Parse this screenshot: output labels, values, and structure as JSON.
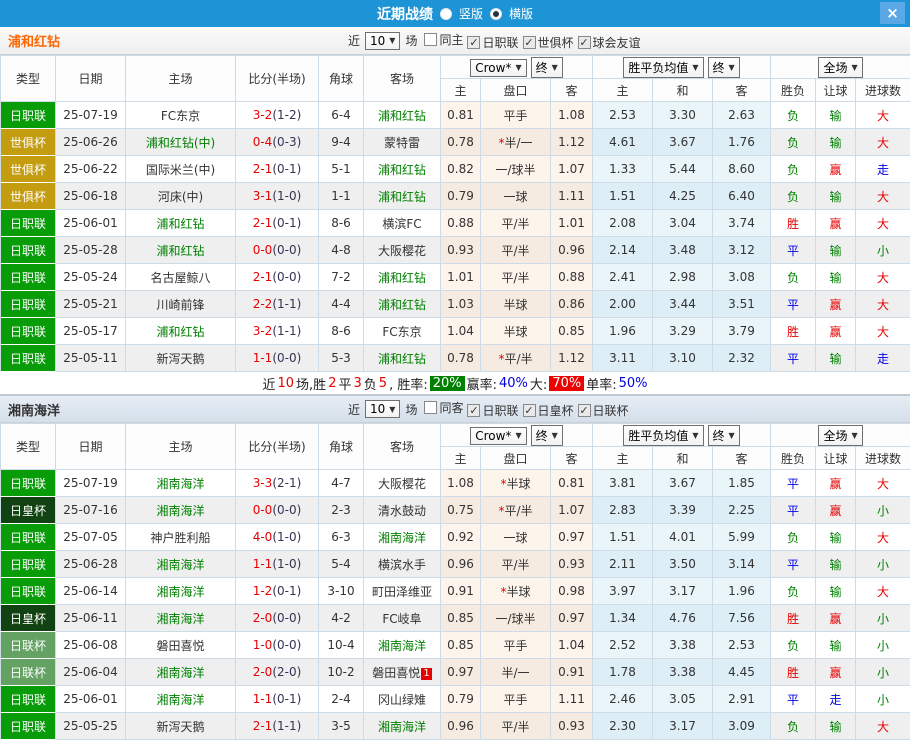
{
  "titlebar": {
    "title": "近期战绩",
    "layout_options": [
      {
        "label": "竖版",
        "selected": false
      },
      {
        "label": "横版",
        "selected": true
      }
    ],
    "close": "×"
  },
  "theme": {
    "titlebar_bg": "#1d94d6",
    "close_btn_bg": "#5aa9e6",
    "section1_name_color": "#ff6600",
    "win_color": "#e60000",
    "draw_color": "#0000e6",
    "lose_color": "#008000",
    "type_colors": {
      "日职联": "#089c08",
      "世俱杯": "#c39c10",
      "日皇杯": "#114211",
      "日联杯": "#63a263"
    }
  },
  "table_header": {
    "cols": [
      "类型",
      "日期",
      "主场",
      "比分(半场)",
      "角球",
      "客场"
    ],
    "sub": [
      "主",
      "盘口",
      "客",
      "主",
      "和",
      "客",
      "胜负",
      "让球",
      "进球数"
    ],
    "selects": {
      "odds_source": "Crow*",
      "odds_stage": "终",
      "avg_label": "胜平负均值",
      "avg_stage": "终",
      "scope": "全场"
    }
  },
  "sections": [
    {
      "name": "浦和红钻",
      "near_label": "近",
      "count": "10",
      "games_label": "场",
      "filters": [
        {
          "label": "同主",
          "checked": false
        },
        {
          "label": "日职联",
          "checked": true
        },
        {
          "label": "世俱杯",
          "checked": true
        },
        {
          "label": "球会友谊",
          "checked": true
        }
      ],
      "rows": [
        {
          "type": "日职联",
          "date": "25-07-19",
          "home": "FC东京",
          "home_green": false,
          "score": "3-2",
          "half": "(1-2)",
          "corner": "6-4",
          "away": "浦和红钻",
          "away_green": true,
          "odds": [
            "0.81",
            "平手",
            "1.08"
          ],
          "avg": [
            "2.53",
            "3.30",
            "2.63"
          ],
          "res": "负",
          "let": "输",
          "goal": "大"
        },
        {
          "type": "世俱杯",
          "date": "25-06-26",
          "home": "浦和红钻(中)",
          "home_green": true,
          "score": "0-4",
          "half": "(0-3)",
          "corner": "9-4",
          "away": "蒙特雷",
          "away_green": false,
          "odds": [
            "0.78",
            "*半/一",
            "1.12"
          ],
          "avg": [
            "4.61",
            "3.67",
            "1.76"
          ],
          "res": "负",
          "let": "输",
          "goal": "大"
        },
        {
          "type": "世俱杯",
          "date": "25-06-22",
          "home": "国际米兰(中)",
          "home_green": false,
          "score": "2-1",
          "half": "(0-1)",
          "corner": "5-1",
          "away": "浦和红钻",
          "away_green": true,
          "odds": [
            "0.82",
            "一/球半",
            "1.07"
          ],
          "avg": [
            "1.33",
            "5.44",
            "8.60"
          ],
          "res": "负",
          "let": "赢",
          "goal": "走"
        },
        {
          "type": "世俱杯",
          "date": "25-06-18",
          "home": "河床(中)",
          "home_green": false,
          "score": "3-1",
          "half": "(1-0)",
          "corner": "1-1",
          "away": "浦和红钻",
          "away_green": true,
          "odds": [
            "0.79",
            "一球",
            "1.11"
          ],
          "avg": [
            "1.51",
            "4.25",
            "6.40"
          ],
          "res": "负",
          "let": "输",
          "goal": "大"
        },
        {
          "type": "日职联",
          "date": "25-06-01",
          "home": "浦和红钻",
          "home_green": true,
          "score": "2-1",
          "half": "(0-1)",
          "corner": "8-6",
          "away": "横滨FC",
          "away_green": false,
          "odds": [
            "0.88",
            "平/半",
            "1.01"
          ],
          "avg": [
            "2.08",
            "3.04",
            "3.74"
          ],
          "res": "胜",
          "let": "赢",
          "goal": "大"
        },
        {
          "type": "日职联",
          "date": "25-05-28",
          "home": "浦和红钻",
          "home_green": true,
          "score": "0-0",
          "half": "(0-0)",
          "corner": "4-8",
          "away": "大阪樱花",
          "away_green": false,
          "odds": [
            "0.93",
            "平/半",
            "0.96"
          ],
          "avg": [
            "2.14",
            "3.48",
            "3.12"
          ],
          "res": "平",
          "let": "输",
          "goal": "小"
        },
        {
          "type": "日职联",
          "date": "25-05-24",
          "home": "名古屋鲸八",
          "home_green": false,
          "score": "2-1",
          "half": "(0-0)",
          "corner": "7-2",
          "away": "浦和红钻",
          "away_green": true,
          "odds": [
            "1.01",
            "平/半",
            "0.88"
          ],
          "avg": [
            "2.41",
            "2.98",
            "3.08"
          ],
          "res": "负",
          "let": "输",
          "goal": "大"
        },
        {
          "type": "日职联",
          "date": "25-05-21",
          "home": "川崎前锋",
          "home_green": false,
          "score": "2-2",
          "half": "(1-1)",
          "corner": "4-4",
          "away": "浦和红钻",
          "away_green": true,
          "odds": [
            "1.03",
            "半球",
            "0.86"
          ],
          "avg": [
            "2.00",
            "3.44",
            "3.51"
          ],
          "res": "平",
          "let": "赢",
          "goal": "大"
        },
        {
          "type": "日职联",
          "date": "25-05-17",
          "home": "浦和红钻",
          "home_green": true,
          "score": "3-2",
          "half": "(1-1)",
          "corner": "8-6",
          "away": "FC东京",
          "away_green": false,
          "odds": [
            "1.04",
            "半球",
            "0.85"
          ],
          "avg": [
            "1.96",
            "3.29",
            "3.79"
          ],
          "res": "胜",
          "let": "赢",
          "goal": "大"
        },
        {
          "type": "日职联",
          "date": "25-05-11",
          "home": "新泻天鹅",
          "home_green": false,
          "score": "1-1",
          "half": "(0-0)",
          "corner": "5-3",
          "away": "浦和红钻",
          "away_green": true,
          "odds": [
            "0.78",
            "*平/半",
            "1.12"
          ],
          "avg": [
            "3.11",
            "3.10",
            "2.32"
          ],
          "res": "平",
          "let": "输",
          "goal": "走"
        }
      ],
      "summary": [
        {
          "t": "近"
        },
        {
          "t": "10",
          "c": "red"
        },
        {
          "t": "场,胜"
        },
        {
          "t": "2",
          "c": "red"
        },
        {
          "t": "平"
        },
        {
          "t": "3",
          "c": "red"
        },
        {
          "t": "负"
        },
        {
          "t": "5",
          "c": "red"
        },
        {
          "t": ", 胜率: "
        },
        {
          "t": "20%",
          "badge": "green"
        },
        {
          "t": " 赢率:"
        },
        {
          "t": "40%",
          "c": "blue"
        },
        {
          "t": " 大: "
        },
        {
          "t": "70%",
          "badge": "red"
        },
        {
          "t": " 单率:"
        },
        {
          "t": "50%",
          "c": "blue"
        }
      ]
    },
    {
      "name": "湘南海洋",
      "near_label": "近",
      "count": "10",
      "games_label": "场",
      "filters": [
        {
          "label": "同客",
          "checked": false
        },
        {
          "label": "日职联",
          "checked": true
        },
        {
          "label": "日皇杯",
          "checked": true
        },
        {
          "label": "日联杯",
          "checked": true
        }
      ],
      "rows": [
        {
          "type": "日职联",
          "date": "25-07-19",
          "home": "湘南海洋",
          "home_green": true,
          "score": "3-3",
          "half": "(2-1)",
          "corner": "4-7",
          "away": "大阪樱花",
          "away_green": false,
          "odds": [
            "1.08",
            "*半球",
            "0.81"
          ],
          "avg": [
            "3.81",
            "3.67",
            "1.85"
          ],
          "res": "平",
          "let": "赢",
          "goal": "大"
        },
        {
          "type": "日皇杯",
          "date": "25-07-16",
          "home": "湘南海洋",
          "home_green": true,
          "score": "0-0",
          "half": "(0-0)",
          "corner": "2-3",
          "away": "清水鼓动",
          "away_green": false,
          "odds": [
            "0.75",
            "*平/半",
            "1.07"
          ],
          "avg": [
            "2.83",
            "3.39",
            "2.25"
          ],
          "res": "平",
          "let": "赢",
          "goal": "小"
        },
        {
          "type": "日职联",
          "date": "25-07-05",
          "home": "神户胜利船",
          "home_green": false,
          "score": "4-0",
          "half": "(1-0)",
          "corner": "6-3",
          "away": "湘南海洋",
          "away_green": true,
          "odds": [
            "0.92",
            "一球",
            "0.97"
          ],
          "avg": [
            "1.51",
            "4.01",
            "5.99"
          ],
          "res": "负",
          "let": "输",
          "goal": "大"
        },
        {
          "type": "日职联",
          "date": "25-06-28",
          "home": "湘南海洋",
          "home_green": true,
          "score": "1-1",
          "half": "(1-0)",
          "corner": "5-4",
          "away": "横滨水手",
          "away_green": false,
          "odds": [
            "0.96",
            "平/半",
            "0.93"
          ],
          "avg": [
            "2.11",
            "3.50",
            "3.14"
          ],
          "res": "平",
          "let": "输",
          "goal": "小"
        },
        {
          "type": "日职联",
          "date": "25-06-14",
          "home": "湘南海洋",
          "home_green": true,
          "score": "1-2",
          "half": "(0-1)",
          "corner": "3-10",
          "away": "町田泽维亚",
          "away_green": false,
          "odds": [
            "0.91",
            "*半球",
            "0.98"
          ],
          "avg": [
            "3.97",
            "3.17",
            "1.96"
          ],
          "res": "负",
          "let": "输",
          "goal": "大"
        },
        {
          "type": "日皇杯",
          "date": "25-06-11",
          "home": "湘南海洋",
          "home_green": true,
          "score": "2-0",
          "half": "(0-0)",
          "corner": "4-2",
          "away": "FC岐阜",
          "away_green": false,
          "odds": [
            "0.85",
            "一/球半",
            "0.97"
          ],
          "avg": [
            "1.34",
            "4.76",
            "7.56"
          ],
          "res": "胜",
          "let": "赢",
          "goal": "小"
        },
        {
          "type": "日联杯",
          "date": "25-06-08",
          "home": "磐田喜悦",
          "home_green": false,
          "score": "1-0",
          "half": "(0-0)",
          "corner": "10-4",
          "away": "湘南海洋",
          "away_green": true,
          "odds": [
            "0.85",
            "平手",
            "1.04"
          ],
          "avg": [
            "2.52",
            "3.38",
            "2.53"
          ],
          "res": "负",
          "let": "输",
          "goal": "小"
        },
        {
          "type": "日联杯",
          "date": "25-06-04",
          "home": "湘南海洋",
          "home_green": true,
          "score": "2-0",
          "half": "(2-0)",
          "corner": "10-2",
          "away": "磐田喜悦",
          "away_green": false,
          "away_badge": "1",
          "odds": [
            "0.97",
            "半/一",
            "0.91"
          ],
          "avg": [
            "1.78",
            "3.38",
            "4.45"
          ],
          "res": "胜",
          "let": "赢",
          "goal": "小"
        },
        {
          "type": "日职联",
          "date": "25-06-01",
          "home": "湘南海洋",
          "home_green": true,
          "score": "1-1",
          "half": "(0-1)",
          "corner": "2-4",
          "away": "冈山绿雉",
          "away_green": false,
          "odds": [
            "0.79",
            "平手",
            "1.11"
          ],
          "avg": [
            "2.46",
            "3.05",
            "2.91"
          ],
          "res": "平",
          "let": "走",
          "goal": "小"
        },
        {
          "type": "日职联",
          "date": "25-05-25",
          "home": "新泻天鹅",
          "home_green": false,
          "score": "2-1",
          "half": "(1-1)",
          "corner": "3-5",
          "away": "湘南海洋",
          "away_green": true,
          "odds": [
            "0.96",
            "平/半",
            "0.93"
          ],
          "avg": [
            "2.30",
            "3.17",
            "3.09"
          ],
          "res": "负",
          "let": "输",
          "goal": "大"
        }
      ]
    }
  ]
}
